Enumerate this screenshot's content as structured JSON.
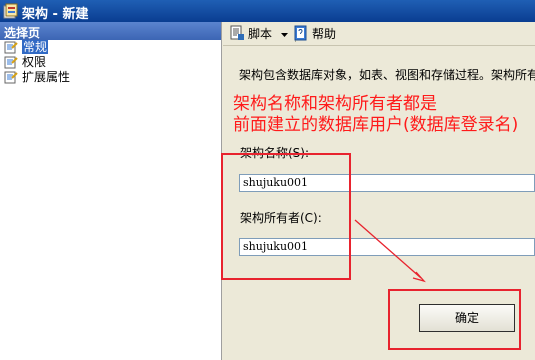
{
  "window": {
    "title": "架构 - 新建"
  },
  "left_pane": {
    "header": "选择页",
    "pages": [
      {
        "label": "常规",
        "selected": true,
        "icon": "page-icon"
      },
      {
        "label": "权限",
        "selected": false,
        "icon": "page-icon"
      },
      {
        "label": "扩展属性",
        "selected": false,
        "icon": "page-icon"
      }
    ]
  },
  "toolbar": {
    "script_label": "脚本",
    "help_label": "帮助",
    "script_icon": "script-icon",
    "dropdown_icon": "triangle-down-icon",
    "help_icon": "help-icon"
  },
  "form": {
    "description": "架构包含数据库对象，如表、视图和存储过程。架构所有",
    "annotation_line1": "架构名称和架构所有者都是",
    "annotation_line2": "前面建立的数据库用户(数据库登录名)",
    "schema_name_label": "架构名称(S):",
    "schema_name_value": "shujuku001",
    "schema_owner_label": "架构所有者(C):",
    "schema_owner_value": "shujuku001",
    "ok_label": "确定"
  },
  "colors": {
    "annotation": "#ff1a1a",
    "title_bar": "#0a3d91",
    "selection": "#316ac5"
  }
}
